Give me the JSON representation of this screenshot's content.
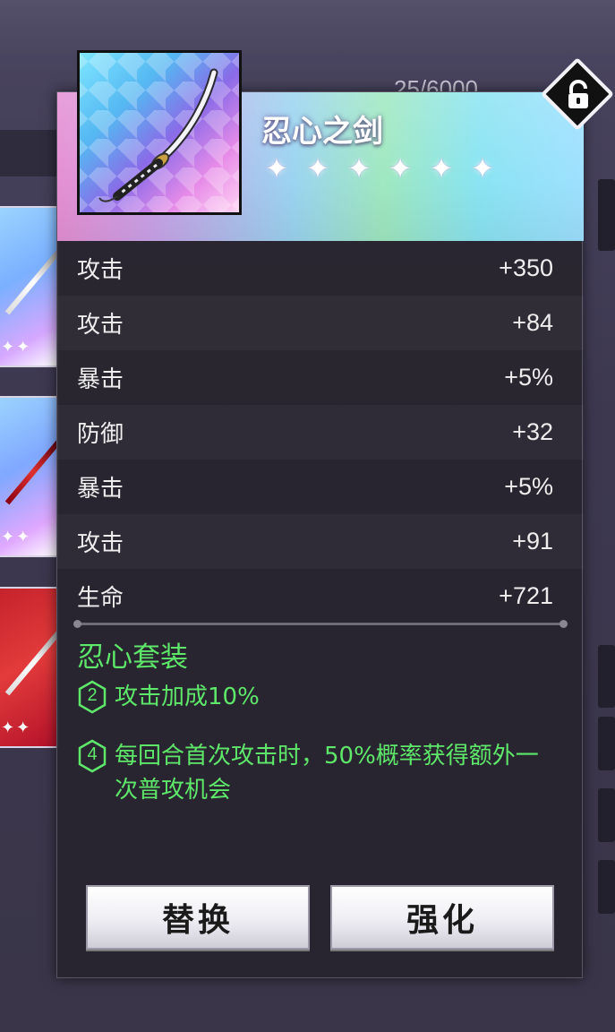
{
  "background": {
    "counter": "25/6000"
  },
  "item": {
    "name": "忍心之剑",
    "stars": [
      "✦",
      "✦",
      "✦",
      "✦",
      "✦",
      "✦"
    ],
    "icon": "katana-icon",
    "rarity_colors": [
      "#e58fd3",
      "#9bd4f0",
      "#9fe8c0",
      "#8ae4f2"
    ]
  },
  "lock": {
    "icon": "lock-icon",
    "state": "unlocked"
  },
  "stats": [
    {
      "label": "攻击",
      "value": "+350"
    },
    {
      "label": "攻击",
      "value": "+84"
    },
    {
      "label": "暴击",
      "value": "+5%"
    },
    {
      "label": "防御",
      "value": "+32"
    },
    {
      "label": "暴击",
      "value": "+5%"
    },
    {
      "label": "攻击",
      "value": "+91"
    },
    {
      "label": "生命",
      "value": "+721"
    }
  ],
  "set": {
    "name": "忍心套装",
    "color": "#5ee86a",
    "effects": [
      {
        "pieces": "2",
        "text": "攻击加成10%"
      },
      {
        "pieces": "4",
        "text": "每回合首次攻击时，50%概率获得额外一次普攻机会"
      }
    ]
  },
  "buttons": {
    "replace": "替换",
    "upgrade": "强化"
  }
}
